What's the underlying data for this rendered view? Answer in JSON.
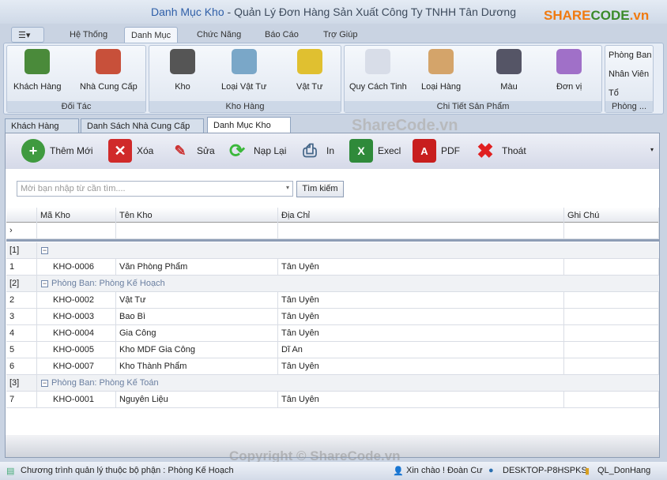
{
  "window": {
    "title_doc": "Danh Mục Kho",
    "title_app": " - Quản Lý Đơn Hàng Sản Xuất Công Ty TNHH Tân Dương",
    "logo": "SHARECODE.vn"
  },
  "ribbon_tabs": [
    "Hệ Thống",
    "Danh Mục",
    "Chức Năng",
    "Báo Cáo",
    "Trợ Giúp"
  ],
  "ribbon_groups": [
    {
      "caption": "Đối Tác",
      "buttons": [
        "Khách Hàng",
        "Nhà Cung Cấp"
      ]
    },
    {
      "caption": "Kho Hàng",
      "buttons": [
        "Kho",
        "Loại Vật Tư",
        "Vật Tư"
      ]
    },
    {
      "caption": "Chi Tiết Sản Phẩm",
      "buttons": [
        "Quy Cách Tinh",
        "Loại Hàng",
        "Màu",
        "Đơn vị"
      ]
    },
    {
      "caption": "Phòng ...",
      "buttons": [
        "Phòng Ban",
        "Nhân Viên",
        "Tổ"
      ]
    }
  ],
  "doc_tabs": [
    "Khách Hàng",
    "Danh Sách Nhà Cung Cấp",
    "Danh Mục Kho"
  ],
  "toolbar": [
    "Thêm Mới",
    "Xóa",
    "Sửa",
    "Nạp Lại",
    "In",
    "Execl",
    "PDF",
    "Thoát"
  ],
  "search": {
    "placeholder": "Mời bạn nhập từ cần tìm....",
    "button": "Tìm kiếm"
  },
  "grid": {
    "columns": [
      "Mã Kho",
      "Tên Kho",
      "Địa Chỉ",
      "Ghi Chú"
    ],
    "groups": [
      {
        "index": "[1]",
        "label": "",
        "rows": [
          {
            "n": "1",
            "ma": "KHO-0006",
            "ten": "Văn Phòng Phẩm",
            "dc": "Tân Uyên",
            "gc": ""
          }
        ]
      },
      {
        "index": "[2]",
        "label": "Phòng Ban: Phòng Kế Hoạch",
        "rows": [
          {
            "n": "2",
            "ma": "KHO-0002",
            "ten": "Vật Tư",
            "dc": "Tân Uyên",
            "gc": ""
          },
          {
            "n": "3",
            "ma": "KHO-0003",
            "ten": "Bao Bì",
            "dc": "Tân Uyên",
            "gc": ""
          },
          {
            "n": "4",
            "ma": "KHO-0004",
            "ten": "Gia Công",
            "dc": "Tân Uyên",
            "gc": ""
          },
          {
            "n": "5",
            "ma": "KHO-0005",
            "ten": "Kho MDF Gia Công",
            "dc": "Dĩ An",
            "gc": ""
          },
          {
            "n": "6",
            "ma": "KHO-0007",
            "ten": "Kho Thành Phẩm",
            "dc": "Tân Uyên",
            "gc": ""
          }
        ]
      },
      {
        "index": "[3]",
        "label": "Phòng Ban: Phòng Kế Toán",
        "rows": [
          {
            "n": "7",
            "ma": "KHO-0001",
            "ten": "Nguyên Liệu",
            "dc": "Tân Uyên",
            "gc": ""
          }
        ]
      }
    ]
  },
  "status": {
    "left": "Chương trình quản lý thuộc bộ phận : Phòng Kế Hoạch",
    "user": "Xin chào ! Đoàn Cư",
    "machine": "DESKTOP-P8HSPKS",
    "db": "QL_DonHang"
  },
  "watermarks": [
    "ShareCode.vn",
    "Copyright © ShareCode.vn"
  ]
}
